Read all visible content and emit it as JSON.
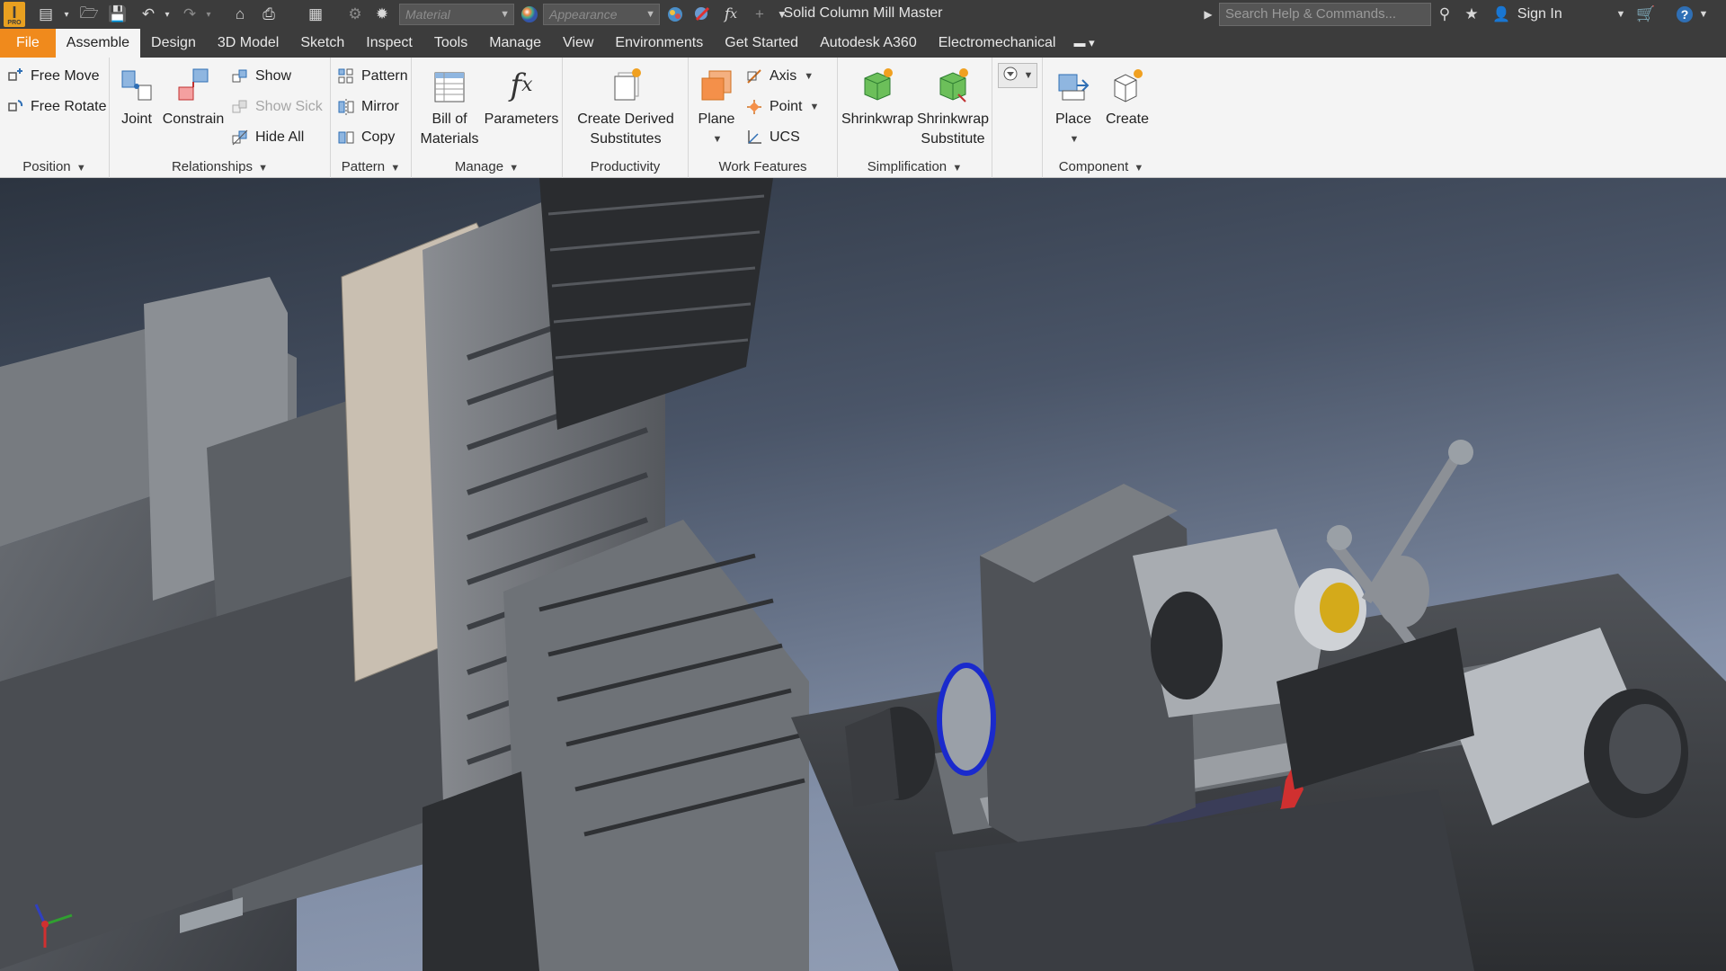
{
  "titlebar": {
    "document_title": "Solid Column Mill Master",
    "material_placeholder": "Material",
    "appearance_placeholder": "Appearance",
    "search_placeholder": "Search Help & Commands...",
    "sign_in": "Sign In",
    "logo_letter": "I",
    "logo_sub": "PRO"
  },
  "tabs": [
    {
      "label": "File"
    },
    {
      "label": "Assemble"
    },
    {
      "label": "Design"
    },
    {
      "label": "3D Model"
    },
    {
      "label": "Sketch"
    },
    {
      "label": "Inspect"
    },
    {
      "label": "Tools"
    },
    {
      "label": "Manage"
    },
    {
      "label": "View"
    },
    {
      "label": "Environments"
    },
    {
      "label": "Get Started"
    },
    {
      "label": "Autodesk A360"
    },
    {
      "label": "Electromechanical"
    }
  ],
  "ribbon": {
    "position": {
      "title": "Position",
      "free_move": "Free Move",
      "free_rotate": "Free Rotate"
    },
    "relationships": {
      "title": "Relationships",
      "joint": "Joint",
      "constrain": "Constrain",
      "show": "Show",
      "show_sick": "Show Sick",
      "hide_all": "Hide All"
    },
    "pattern": {
      "title": "Pattern",
      "pattern": "Pattern",
      "mirror": "Mirror",
      "copy": "Copy"
    },
    "manage": {
      "title": "Manage",
      "bom_line1": "Bill of",
      "bom_line2": "Materials",
      "parameters": "Parameters"
    },
    "productivity": {
      "title": "Productivity",
      "derived_line1": "Create Derived",
      "derived_line2": "Substitutes"
    },
    "work_features": {
      "title": "Work Features",
      "plane": "Plane",
      "axis": "Axis",
      "point": "Point",
      "ucs": "UCS"
    },
    "simplification": {
      "title": "Simplification",
      "shrinkwrap": "Shrinkwrap",
      "shrinkwrap_sub_line1": "Shrinkwrap",
      "shrinkwrap_sub_line2": "Substitute"
    },
    "component": {
      "title": "Component",
      "place": "Place",
      "create": "Create"
    }
  },
  "icons": {
    "quick_access": [
      "new-icon",
      "open-icon",
      "save-icon",
      "undo-icon",
      "redo-icon",
      "home-icon",
      "print-icon",
      "measure-icon",
      "update-icon",
      "color-wheel-icon",
      "appearance-sphere-icon",
      "material-clear-icon",
      "fx-icon",
      "add-icon",
      "customize-icon"
    ]
  },
  "colors": {
    "file_tab": "#f08a1c",
    "accent_green": "#4caf50",
    "accent_blue": "#2f6fb5",
    "axis_x": "#d03030",
    "axis_y": "#30a030",
    "axis_z": "#3040c0"
  }
}
